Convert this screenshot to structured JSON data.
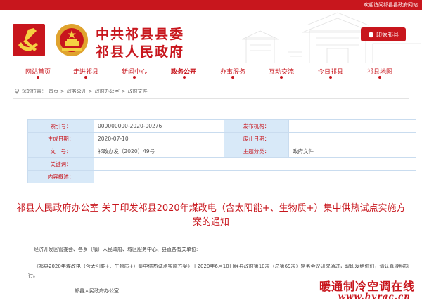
{
  "topbar": {
    "text": "欢迎访问祁县县政府网站"
  },
  "header": {
    "title_line1": "中共祁县县委",
    "title_line2": "祁县人民政府",
    "old_site_label": "印象祁县"
  },
  "nav": {
    "items": [
      {
        "label": "网站首页"
      },
      {
        "label": "走进祁县"
      },
      {
        "label": "新闻中心"
      },
      {
        "label": "政务公开"
      },
      {
        "label": "办事服务"
      },
      {
        "label": "互动交流"
      },
      {
        "label": "今日祁县"
      },
      {
        "label": "祁县地图"
      }
    ],
    "active": "政务公开"
  },
  "breadcrumb": {
    "prefix": "您的位置：",
    "items": [
      "首页",
      "政务公开",
      "政府办公室",
      "政府文件"
    ],
    "separator": ">"
  },
  "meta_table": {
    "rows": [
      {
        "k1": "索引号：",
        "v1": "000000000-2020-00276",
        "k2": "发布机构：",
        "v2": ""
      },
      {
        "k1": "生成日期：",
        "v1": "2020-07-10",
        "k2": "废止日期：",
        "v2": ""
      },
      {
        "k1": "文　号：",
        "v1": "祁政办发〔2020〕49号",
        "k2": "主题分类：",
        "v2": "政府文件"
      },
      {
        "k1": "关键词：",
        "v1": "",
        "k2": "",
        "v2": ""
      },
      {
        "k1": "内容概述：",
        "v1": "",
        "k2": "",
        "v2": ""
      }
    ]
  },
  "document": {
    "title": "祁县人民政府办公室 关于印发祁县2020年煤改电（含太阳能+、生物质+）集中供热试点实施方案的通知",
    "p1": "经济开发区管委会、各乡（镇）人民政府、城区服务中心、县直各有关单位:",
    "p2": "《祁县2020年煤改电（含太阳能+、生物质+）集中供热试点实施方案》于2020年6月10日经县政府第10次（总第69次）常务会议研究通过，现印发给你们，请认真遵照执行。",
    "p3": "祁县人民政府办公室"
  },
  "watermark": {
    "line1": "暖通制冷空调在线",
    "line2": "www.hvrac.cn"
  },
  "colors": {
    "brand_red": "#c8161d",
    "table_key_bg": "#d8e9f8",
    "table_border": "#c9dcef"
  },
  "icons": [
    "party-emblem-icon",
    "national-emblem-icon",
    "location-pin-icon",
    "lantern-icon"
  ]
}
